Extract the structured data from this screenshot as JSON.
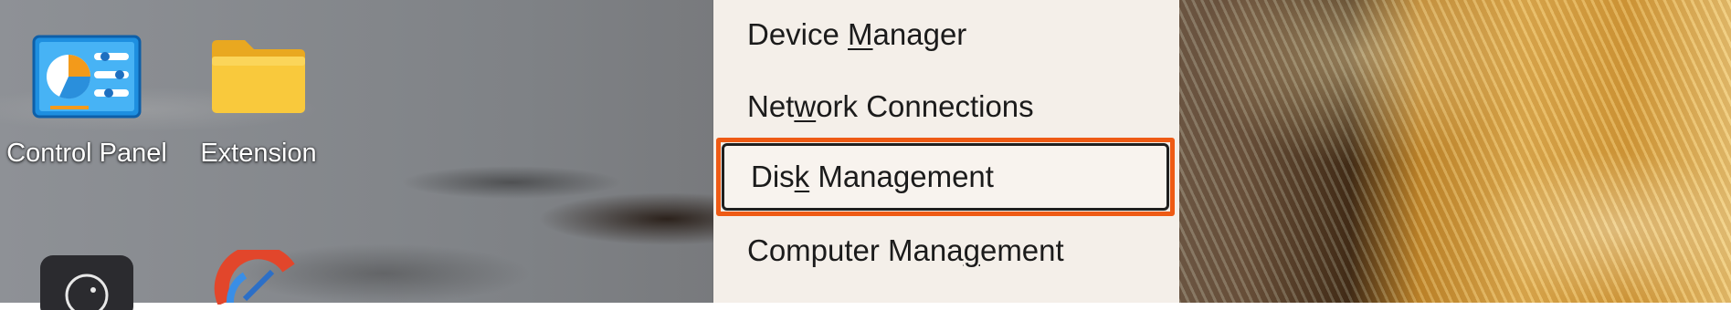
{
  "desktop": {
    "icons": [
      {
        "label": "Control Panel",
        "icon": "control-panel-icon"
      },
      {
        "label": "Extension",
        "icon": "folder-icon"
      },
      {
        "label": "",
        "icon": "app-icon"
      },
      {
        "label": "",
        "icon": "ccleaner-icon"
      }
    ]
  },
  "context_menu": {
    "items": [
      {
        "pre": "Device ",
        "key": "M",
        "post": "anager",
        "highlighted": false
      },
      {
        "pre": "Net",
        "key": "w",
        "post": "ork Connections",
        "highlighted": false
      },
      {
        "pre": "Dis",
        "key": "k",
        "post": " Management",
        "highlighted": true
      },
      {
        "pre": "Computer Mana",
        "key": "g",
        "post": "ement",
        "highlighted": false
      }
    ]
  },
  "colors": {
    "highlight_border": "#ee5a14",
    "menu_background": "#f4efe9"
  }
}
